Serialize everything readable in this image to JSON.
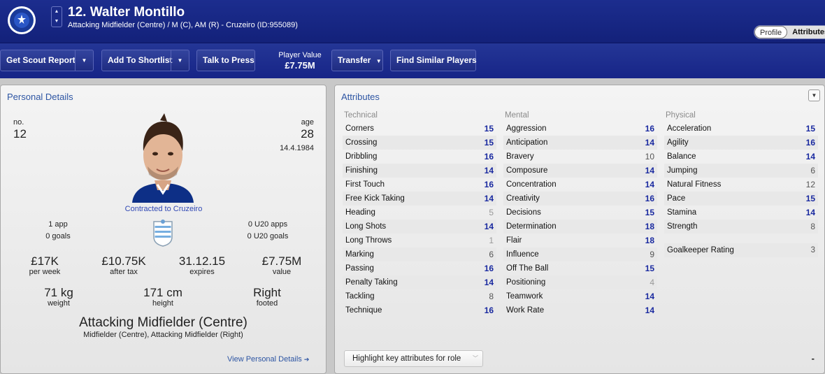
{
  "header": {
    "title": "12. Walter Montillo",
    "subtitle": "Attacking Midfielder (Centre) / M (C), AM (R) - Cruzeiro (ID:955089)",
    "tabs": [
      "Profile",
      "Attributes"
    ]
  },
  "toolbar": {
    "scout": "Get Scout Report",
    "shortlist": "Add To Shortlist",
    "press": "Talk to Press",
    "value_label": "Player Value",
    "value": "£7.75M",
    "transfer": "Transfer",
    "similar": "Find Similar Players"
  },
  "personal": {
    "title": "Personal Details",
    "no_label": "no.",
    "no": "12",
    "age_label": "age",
    "age": "28",
    "dob": "14.4.1984",
    "contract": "Contracted to Cruzeiro",
    "apps": "1 app",
    "goals": "0 goals",
    "u20_apps": "0 U20 apps",
    "u20_goals": "0 U20 goals",
    "wage": "£17K",
    "wage_label": "per week",
    "after_tax": "£10.75K",
    "after_tax_label": "after tax",
    "expires": "31.12.15",
    "expires_label": "expires",
    "value": "£7.75M",
    "value_label": "value",
    "weight": "71 kg",
    "weight_label": "weight",
    "height": "171 cm",
    "height_label": "height",
    "foot": "Right",
    "foot_label": "footed",
    "position": "Attacking Midfielder (Centre)",
    "positions": "Midfielder (Centre), Attacking Midfielder (Right)",
    "link": "View Personal Details"
  },
  "attributes": {
    "title": "Attributes",
    "technical_label": "Technical",
    "mental_label": "Mental",
    "physical_label": "Physical",
    "technical": [
      {
        "name": "Corners",
        "value": 15
      },
      {
        "name": "Crossing",
        "value": 15
      },
      {
        "name": "Dribbling",
        "value": 16
      },
      {
        "name": "Finishing",
        "value": 14
      },
      {
        "name": "First Touch",
        "value": 16
      },
      {
        "name": "Free Kick Taking",
        "value": 14
      },
      {
        "name": "Heading",
        "value": 5
      },
      {
        "name": "Long Shots",
        "value": 14
      },
      {
        "name": "Long Throws",
        "value": 1
      },
      {
        "name": "Marking",
        "value": 6
      },
      {
        "name": "Passing",
        "value": 16
      },
      {
        "name": "Penalty Taking",
        "value": 14
      },
      {
        "name": "Tackling",
        "value": 8
      },
      {
        "name": "Technique",
        "value": 16
      }
    ],
    "mental": [
      {
        "name": "Aggression",
        "value": 16
      },
      {
        "name": "Anticipation",
        "value": 14
      },
      {
        "name": "Bravery",
        "value": 10
      },
      {
        "name": "Composure",
        "value": 14
      },
      {
        "name": "Concentration",
        "value": 14
      },
      {
        "name": "Creativity",
        "value": 16
      },
      {
        "name": "Decisions",
        "value": 15
      },
      {
        "name": "Determination",
        "value": 18
      },
      {
        "name": "Flair",
        "value": 18
      },
      {
        "name": "Influence",
        "value": 9
      },
      {
        "name": "Off The Ball",
        "value": 15
      },
      {
        "name": "Positioning",
        "value": 4
      },
      {
        "name": "Teamwork",
        "value": 14
      },
      {
        "name": "Work Rate",
        "value": 14
      }
    ],
    "physical": [
      {
        "name": "Acceleration",
        "value": 15
      },
      {
        "name": "Agility",
        "value": 16
      },
      {
        "name": "Balance",
        "value": 14
      },
      {
        "name": "Jumping",
        "value": 6
      },
      {
        "name": "Natural Fitness",
        "value": 12
      },
      {
        "name": "Pace",
        "value": 15
      },
      {
        "name": "Stamina",
        "value": 14
      },
      {
        "name": "Strength",
        "value": 8
      }
    ],
    "gk_label": "Goalkeeper Rating",
    "gk_value": "3",
    "highlight": "Highlight key attributes for role",
    "dash": "-"
  }
}
